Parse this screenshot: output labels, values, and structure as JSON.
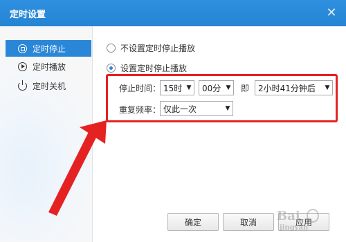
{
  "window": {
    "title": "定时设置"
  },
  "sidebar": {
    "items": [
      {
        "label": "定时停止",
        "icon": "stop-circle-icon",
        "active": true
      },
      {
        "label": "定时播放",
        "icon": "play-circle-icon",
        "active": false
      },
      {
        "label": "定时关机",
        "icon": "power-icon",
        "active": false
      }
    ]
  },
  "options": {
    "no_timer_label": "不设置定时停止播放",
    "set_timer_label": "设置定时停止播放",
    "selected": "set_timer"
  },
  "form": {
    "stop_time_label": "停止时间：",
    "hour_value": "15时",
    "minute_value": "00分",
    "ji_label": "即",
    "after_value": "2小时41分钟后",
    "frequency_label": "重复频率：",
    "frequency_value": "仅此一次"
  },
  "buttons": {
    "ok_label": "确定",
    "cancel_label": "取消",
    "apply_label": "应用"
  },
  "colors": {
    "titlebar": "#2a86d7",
    "highlight": "#e42222",
    "arrow": "#e42222",
    "active_item": "#2a86d7"
  }
}
